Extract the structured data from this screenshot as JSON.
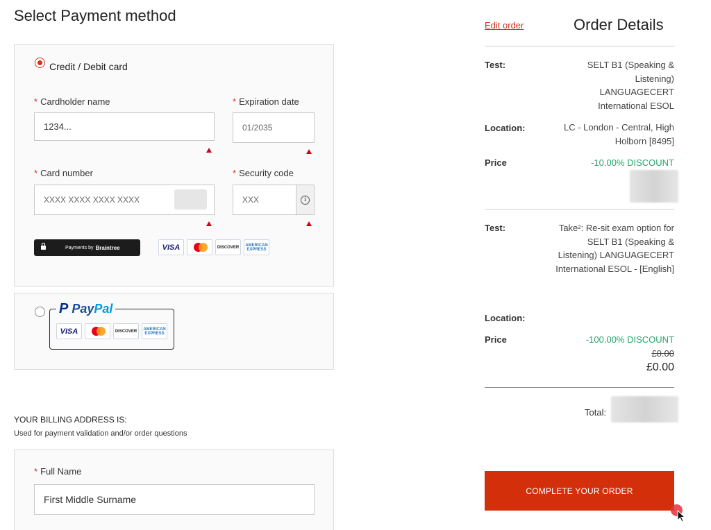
{
  "payment": {
    "title": "Select Payment method",
    "card_option_label": "Credit / Debit card",
    "cardholder_label": "Cardholder name",
    "cardholder_value": "1234...",
    "expiration_label": "Expiration date",
    "expiration_placeholder": "01/2035",
    "card_number_label": "Card number",
    "card_number_placeholder": "XXXX XXXX XXXX XXXX",
    "security_label": "Security code",
    "security_placeholder": "XXX",
    "required_mark": "*",
    "braintree_text": "Payments by",
    "braintree_brand": "Braintree",
    "card_logos": [
      "VISA",
      "MasterCard",
      "DISCOVER",
      "AMERICAN EXPRESS"
    ],
    "paypal_p": "P",
    "paypal_pay": "Pay",
    "paypal_pal": "Pal",
    "info_icon": "i"
  },
  "billing": {
    "title": "YOUR BILLING ADDRESS IS:",
    "subtitle": "Used for payment validation and/or order questions",
    "full_name_label": "Full Name",
    "full_name_value": "First Middle Surname"
  },
  "order": {
    "edit_link": "Edit order",
    "title": "Order Details",
    "item1": {
      "test_key": "Test:",
      "test_value": "SELT B1 (Speaking & Listening) LANGUAGECERT International ESOL",
      "location_key": "Location:",
      "location_value": "LC - London - Central, High Holborn [8495]",
      "price_key": "Price",
      "discount": "-10.00% DISCOUNT"
    },
    "item2": {
      "test_key": "Test:",
      "test_value": "Take²: Re-sit exam option for SELT B1 (Speaking & Listening) LANGUAGECERT International ESOL - [English]",
      "location_key": "Location:",
      "price_key": "Price",
      "discount": "-100.00% DISCOUNT",
      "old_price": "£0.00",
      "new_price": "£0.00"
    },
    "total_label": "Total:",
    "complete_button": "COMPLETE YOUR ORDER"
  },
  "colors": {
    "accent": "#d32f0a",
    "discount_green": "#2aa36b",
    "required_red": "#d0321b"
  }
}
